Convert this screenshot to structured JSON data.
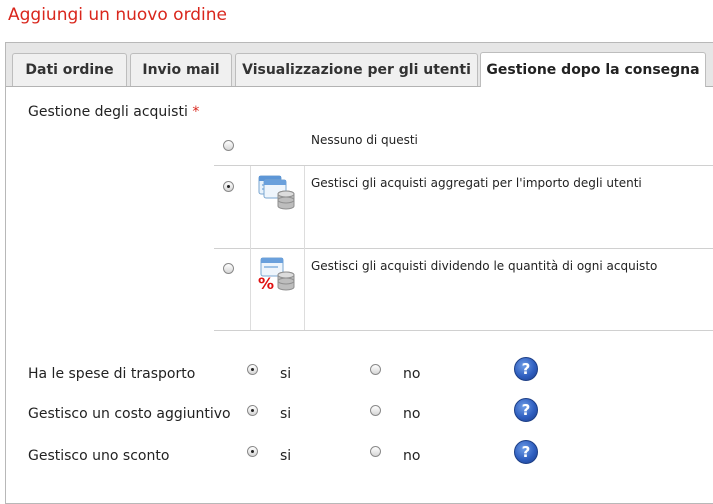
{
  "page": {
    "title": "Aggiungi un nuovo ordine"
  },
  "tabs": [
    {
      "label": "Dati ordine",
      "active": false
    },
    {
      "label": "Invio mail",
      "active": false
    },
    {
      "label": "Visualizzazione per gli utenti",
      "active": false
    },
    {
      "label": "Gestione dopo la consegna",
      "active": true
    }
  ],
  "purchase_management": {
    "label": "Gestione degli acquisti",
    "required_marker": "*",
    "options": [
      {
        "text": "Nessuno di questi",
        "checked": false,
        "icon": "none"
      },
      {
        "text": "Gestisci gli acquisti aggregati per l'importo degli utenti",
        "checked": true,
        "icon": "aggregate-database-icon"
      },
      {
        "text": "Gestisci gli acquisti dividendo le quantità di ogni acquisto",
        "checked": false,
        "icon": "percent-database-icon"
      }
    ]
  },
  "settings": [
    {
      "label": "Ha le spese di trasporto",
      "yes": "si",
      "no": "no",
      "value": "si",
      "help_icon": "help-icon"
    },
    {
      "label": "Gestisco un costo aggiuntivo",
      "yes": "si",
      "no": "no",
      "value": "si",
      "help_icon": "help-icon"
    },
    {
      "label": "Gestisco uno sconto",
      "yes": "si",
      "no": "no",
      "value": "si",
      "help_icon": "help-icon"
    }
  ],
  "colors": {
    "title": "#d9261c",
    "required": "#d9261c",
    "help": "#2f5fc0"
  }
}
